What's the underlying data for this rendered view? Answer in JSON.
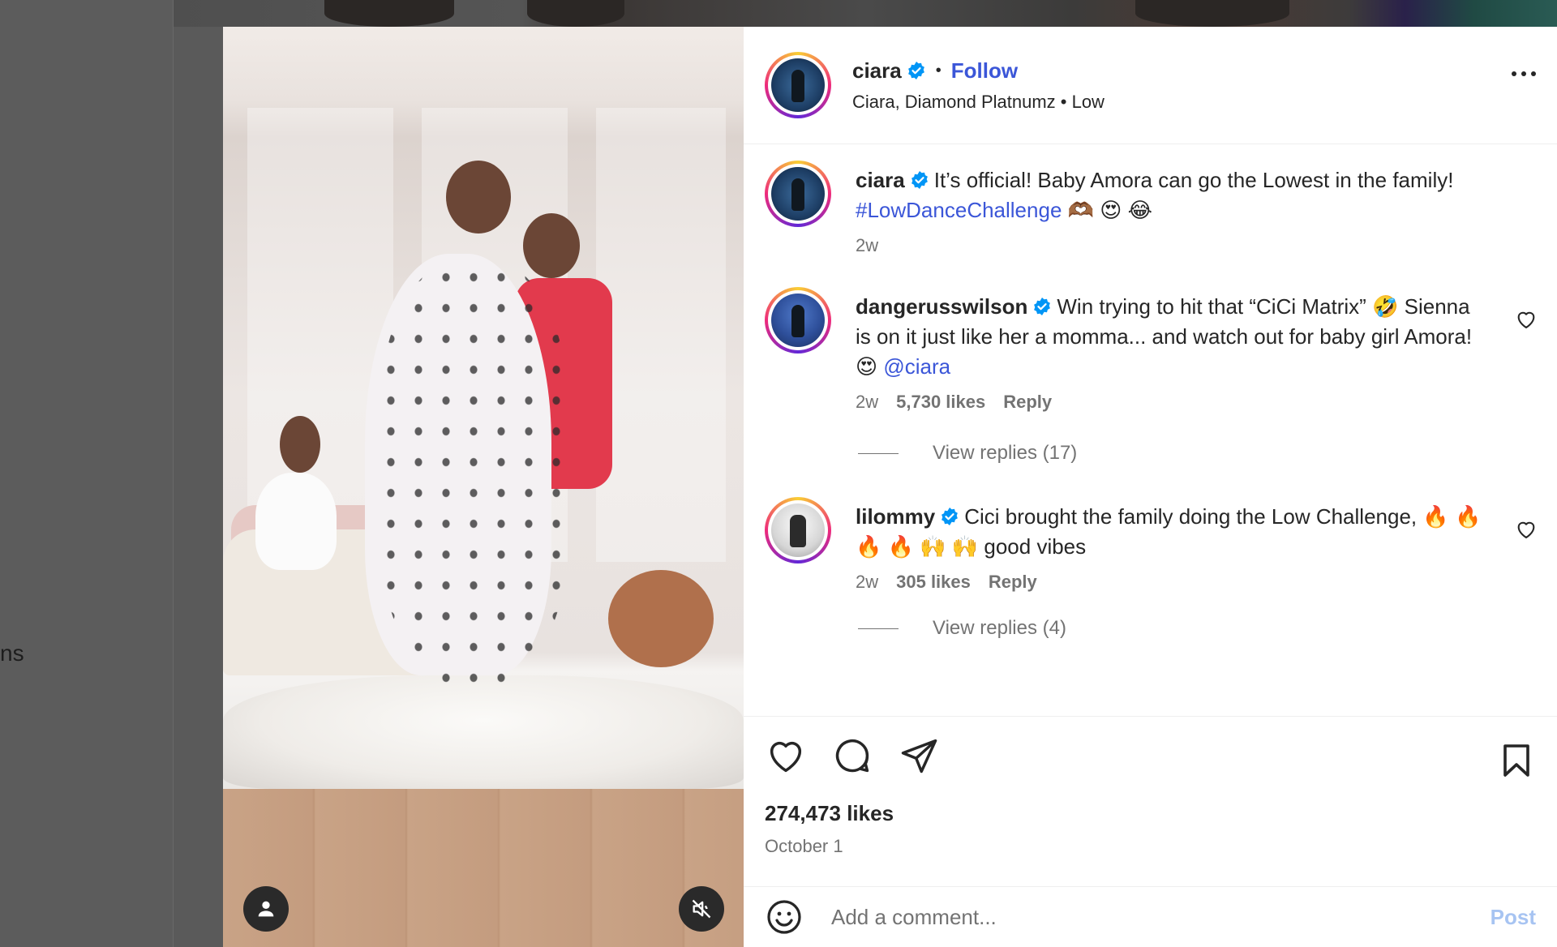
{
  "background": {
    "side_text": "ns"
  },
  "post": {
    "author": "ciara",
    "follow_label": "Follow",
    "audio": "Ciara, Diamond Platnumz • Low",
    "separator": "•",
    "avatar_text": "ciara"
  },
  "caption": {
    "username": "ciara",
    "text": "It’s official! Baby Amora can go the Lowest in the family!",
    "hashtag": "#LowDanceChallenge",
    "emoji": "🫶🏾 😍 😂",
    "time": "2w"
  },
  "comments": [
    {
      "username": "dangerusswilson",
      "text": "Win trying to hit that “CiCi Matrix” 🤣 Sienna is on it just like her a momma... and watch out for baby girl Amora! 😍",
      "mention": "@ciara",
      "time": "2w",
      "likes": "5,730 likes",
      "reply_label": "Reply",
      "view_replies": "View replies (17)"
    },
    {
      "username": "lilommy",
      "text": "Cici brought the family doing the Low Challenge, 🔥 🔥 🔥 🔥 🙌 🙌 good vibes",
      "time": "2w",
      "likes": "305 likes",
      "reply_label": "Reply",
      "view_replies": "View replies (4)"
    }
  ],
  "summary": {
    "likes": "274,473 likes",
    "date": "October 1"
  },
  "composer": {
    "placeholder": "Add a comment...",
    "post_label": "Post"
  },
  "colors": {
    "link": "#3b56d8",
    "verified": "#0095f6",
    "post_disabled": "#a7c4f2"
  }
}
